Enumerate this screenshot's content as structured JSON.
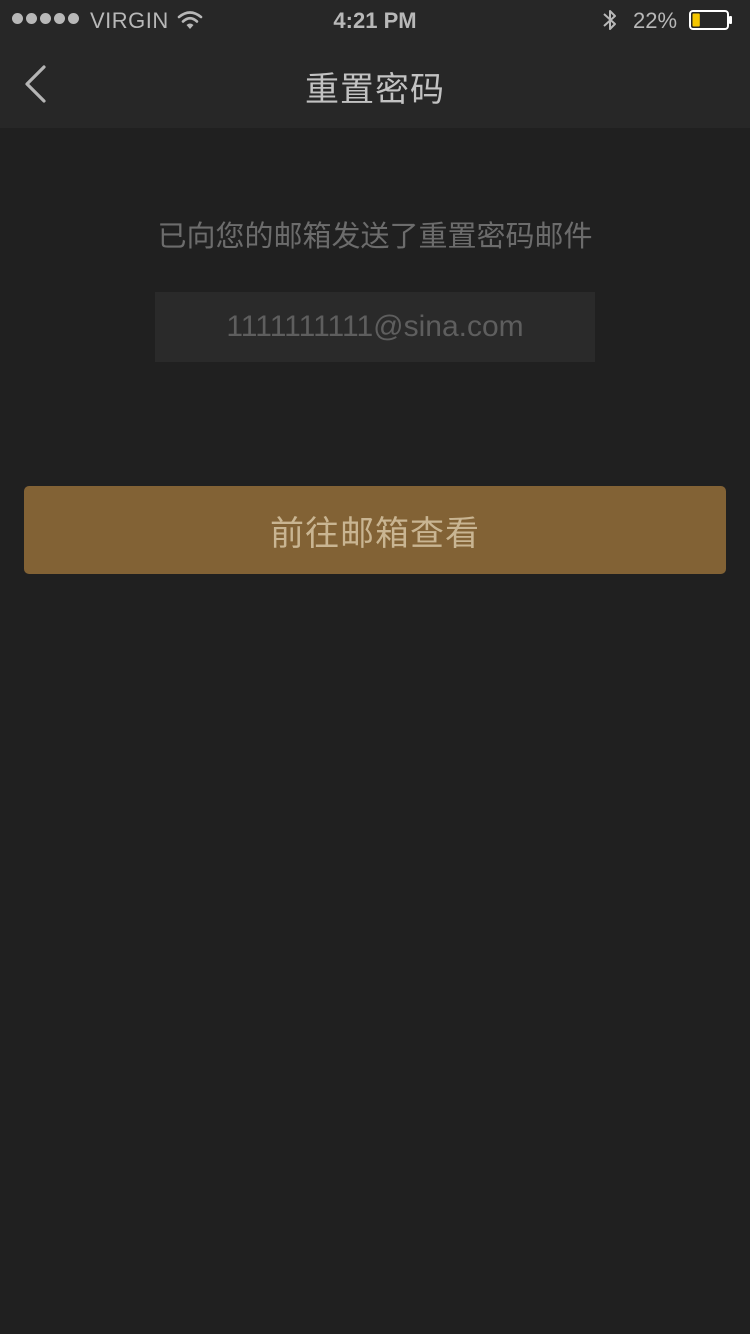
{
  "status_bar": {
    "carrier": "VIRGIN",
    "time": "4:21 PM",
    "battery_percent": "22%",
    "battery_level": 0.22,
    "battery_color": "#f4c600",
    "icons": [
      "signal-dots-icon",
      "wifi-icon",
      "bluetooth-icon",
      "battery-icon"
    ]
  },
  "nav": {
    "title": "重置密码",
    "back_icon": "chevron-left-icon"
  },
  "content": {
    "message": "已向您的邮箱发送了重置密码邮件",
    "email": "1111111111@sina.com",
    "button_label": "前往邮箱查看"
  },
  "colors": {
    "background": "#202020",
    "accent": "#826235"
  }
}
